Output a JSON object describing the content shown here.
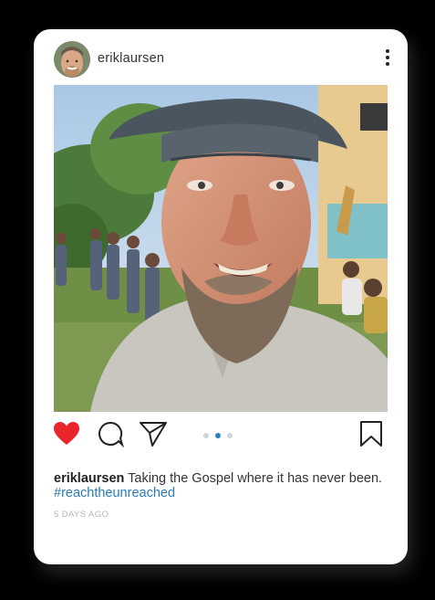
{
  "post": {
    "username": "eriklaursen",
    "caption_user": "eriklaursen",
    "caption_text": "Taking the Gospel where it has never been.",
    "hashtag": "#reachtheunreached",
    "timestamp": "5 DAYS AGO"
  },
  "carousel": {
    "total": 3,
    "active_index": 1
  },
  "icons": {
    "like": "heart-icon",
    "comment": "comment-icon",
    "share": "send-icon",
    "save": "bookmark-icon",
    "more": "more-vertical-icon"
  },
  "colors": {
    "like_active": "#e8262b",
    "hashtag": "#2a7bb6",
    "active_dot": "#2d83b8",
    "inactive_dot": "#cfd4d9"
  }
}
